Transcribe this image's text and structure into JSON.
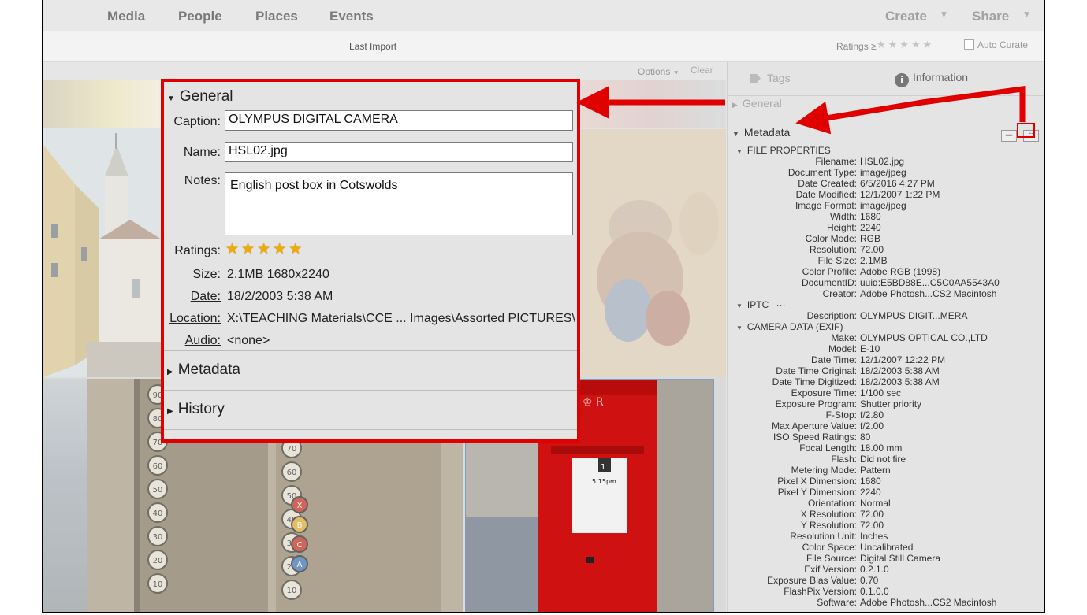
{
  "nav": {
    "media": "Media",
    "people": "People",
    "places": "Places",
    "events": "Events",
    "create": "Create",
    "share": "Share"
  },
  "toolbar": {
    "last_import": "Last Import",
    "ratings_label": "Ratings ≥",
    "ratings_stars": "★★★★★",
    "auto_curate": "Auto Curate"
  },
  "grid": {
    "options": "Options",
    "clear": "Clear"
  },
  "panel": {
    "tab_tags": "Tags",
    "tab_information": "Information",
    "general_label": "General",
    "metadata_label": "Metadata",
    "file_properties_label": "FILE PROPERTIES",
    "iptc_label": "IPTC",
    "iptc_more": "···",
    "camera_label": "CAMERA DATA (EXIF)",
    "file_properties": [
      {
        "k": "Filename:",
        "v": "HSL02.jpg"
      },
      {
        "k": "Document Type:",
        "v": "image/jpeg"
      },
      {
        "k": "Date Created:",
        "v": "6/5/2016 4:27 PM"
      },
      {
        "k": "Date Modified:",
        "v": "12/1/2007 1:22 PM"
      },
      {
        "k": "Image Format:",
        "v": "image/jpeg"
      },
      {
        "k": "Width:",
        "v": "1680"
      },
      {
        "k": "Height:",
        "v": "2240"
      },
      {
        "k": "Color Mode:",
        "v": "RGB"
      },
      {
        "k": "Resolution:",
        "v": "72.00"
      },
      {
        "k": "File Size:",
        "v": "2.1MB"
      },
      {
        "k": "Color Profile:",
        "v": "Adobe RGB (1998)"
      },
      {
        "k": "DocumentID:",
        "v": "uuid:E5BD88E...C5C0AA5543A0"
      },
      {
        "k": "Creator:",
        "v": "Adobe Photosh...CS2 Macintosh"
      }
    ],
    "iptc": [
      {
        "k": "Description:",
        "v": "OLYMPUS DIGIT...MERA"
      }
    ],
    "camera": [
      {
        "k": "Make:",
        "v": "OLYMPUS OPTICAL CO.,LTD"
      },
      {
        "k": "Model:",
        "v": "E-10"
      },
      {
        "k": "Date Time:",
        "v": "12/1/2007 12:22 PM"
      },
      {
        "k": "Date Time Original:",
        "v": "18/2/2003 5:38 AM"
      },
      {
        "k": "Date Time Digitized:",
        "v": "18/2/2003 5:38 AM"
      },
      {
        "k": "Exposure Time:",
        "v": "1/100 sec"
      },
      {
        "k": "Exposure Program:",
        "v": "Shutter priority"
      },
      {
        "k": "F-Stop:",
        "v": "f/2.80"
      },
      {
        "k": "Max Aperture Value:",
        "v": "f/2.00"
      },
      {
        "k": "ISO Speed Ratings:",
        "v": "80"
      },
      {
        "k": "Focal Length:",
        "v": "18.00 mm"
      },
      {
        "k": "Flash:",
        "v": "Did not fire"
      },
      {
        "k": "Metering Mode:",
        "v": "Pattern"
      },
      {
        "k": "Pixel X Dimension:",
        "v": "1680"
      },
      {
        "k": "Pixel Y Dimension:",
        "v": "2240"
      },
      {
        "k": "Orientation:",
        "v": "Normal"
      },
      {
        "k": "X Resolution:",
        "v": "72.00"
      },
      {
        "k": "Y Resolution:",
        "v": "72.00"
      },
      {
        "k": "Resolution Unit:",
        "v": "Inches"
      },
      {
        "k": "Color Space:",
        "v": "Uncalibrated"
      },
      {
        "k": "File Source:",
        "v": "Digital Still Camera"
      },
      {
        "k": "Exif Version:",
        "v": "0.2.1.0"
      },
      {
        "k": "Exposure Bias Value:",
        "v": "0.70"
      },
      {
        "k": "FlashPix Version:",
        "v": "0.1.0.0"
      },
      {
        "k": "Software:",
        "v": "Adobe Photosh...CS2 Macintosh"
      }
    ]
  },
  "callout": {
    "general": "General",
    "caption_label": "Caption:",
    "caption_value": "OLYMPUS DIGITAL CAMERA",
    "name_label": "Name:",
    "name_value": "HSL02.jpg",
    "notes_label": "Notes:",
    "notes_value": "English post box in Cotswolds",
    "ratings_label": "Ratings:",
    "rating": 5,
    "size_label": "Size:",
    "size_value": "2.1MB  1680x2240",
    "date_label": "Date:",
    "date_value": "18/2/2003 5:38 AM",
    "location_label": "Location:",
    "location_value": "X:\\TEACHING Materials\\CCE ... Images\\Assorted PICTURES\\",
    "audio_label": "Audio:",
    "audio_value": "<none>",
    "metadata": "Metadata",
    "history": "History"
  },
  "postbox": {
    "crown": "♔ R",
    "number": "1",
    "time": "5:15pm"
  },
  "register": {
    "keys": [
      "90",
      "80",
      "70",
      "60",
      "50",
      "40",
      "30",
      "20",
      "10"
    ],
    "keys2": [
      "X",
      "B",
      "C",
      "A"
    ]
  },
  "colors": {
    "accent_red": "#e00000",
    "star_gold": "#f2a900",
    "panel_bg": "#e4e4e4"
  }
}
